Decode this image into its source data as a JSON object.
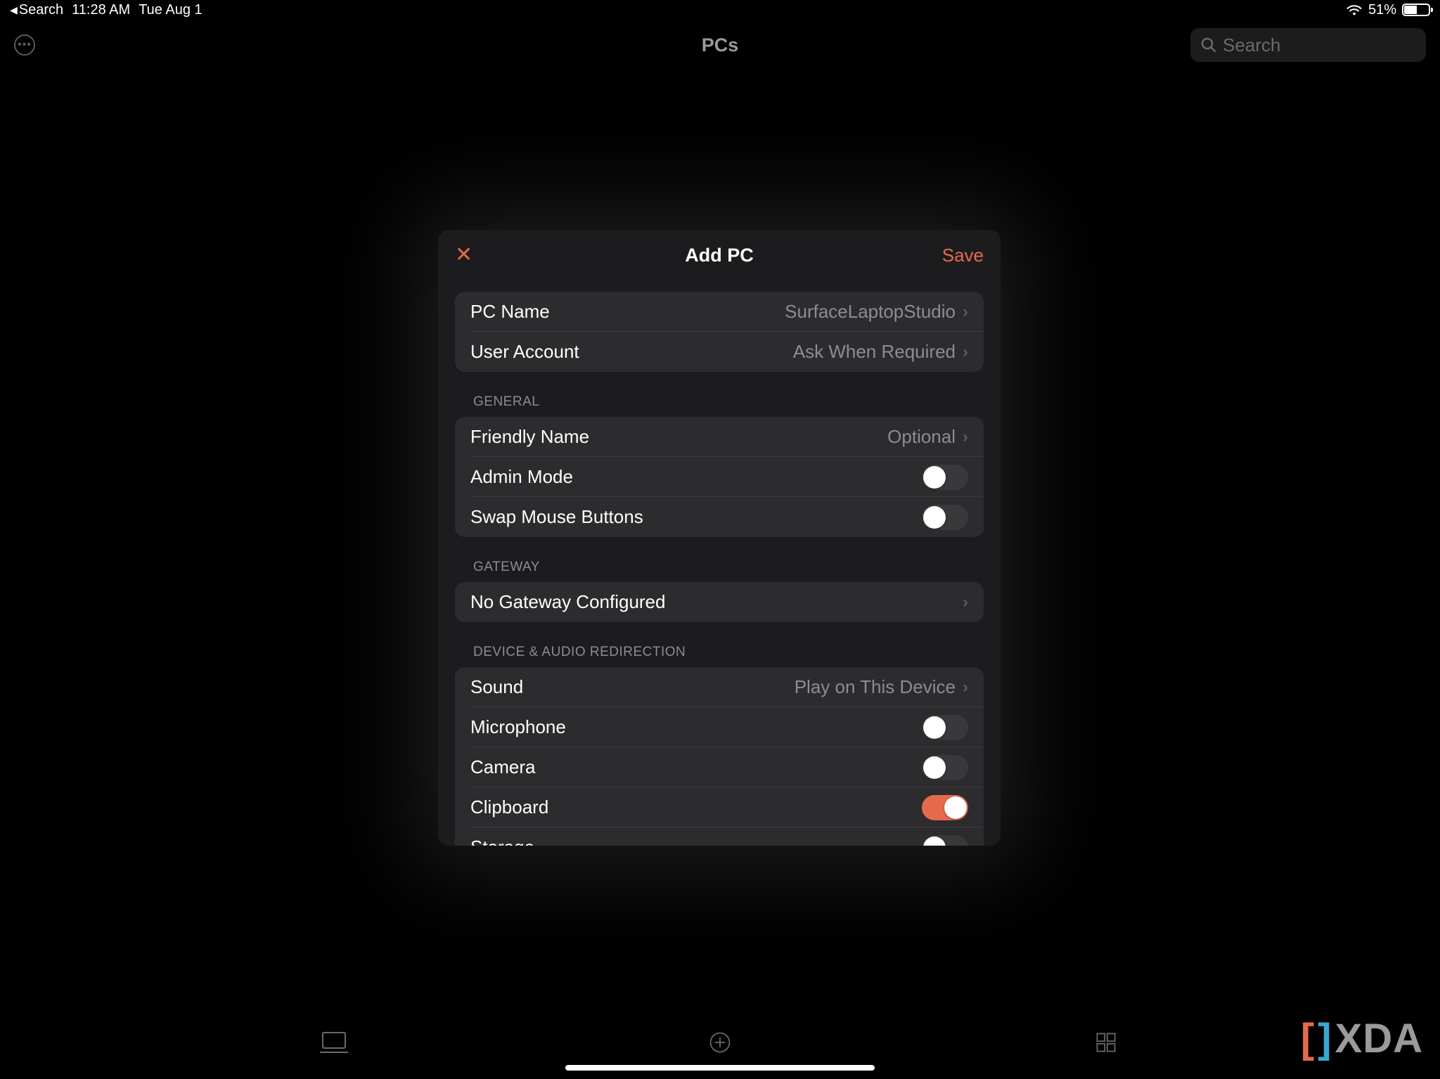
{
  "status": {
    "back_app": "Search",
    "time": "11:28 AM",
    "date": "Tue Aug 1",
    "battery_pct": "51%"
  },
  "nav": {
    "title": "PCs",
    "search_placeholder": "Search"
  },
  "modal": {
    "title": "Add PC",
    "close_label": "✕",
    "save_label": "Save",
    "rows": {
      "pc_name_label": "PC Name",
      "pc_name_value": "SurfaceLaptopStudio",
      "user_account_label": "User Account",
      "user_account_value": "Ask When Required"
    },
    "sections": {
      "general": "General",
      "gateway": "Gateway",
      "redirect": "Device & Audio Redirection"
    },
    "general": {
      "friendly_name_label": "Friendly Name",
      "friendly_name_value": "Optional",
      "admin_mode_label": "Admin Mode",
      "admin_mode_on": false,
      "swap_mouse_label": "Swap Mouse Buttons",
      "swap_mouse_on": false
    },
    "gateway": {
      "none_label": "No Gateway Configured"
    },
    "redirect": {
      "sound_label": "Sound",
      "sound_value": "Play on This Device",
      "microphone_label": "Microphone",
      "microphone_on": false,
      "camera_label": "Camera",
      "camera_on": false,
      "clipboard_label": "Clipboard",
      "clipboard_on": true,
      "storage_label": "Storage",
      "storage_on": false
    }
  },
  "watermark": "XDA"
}
